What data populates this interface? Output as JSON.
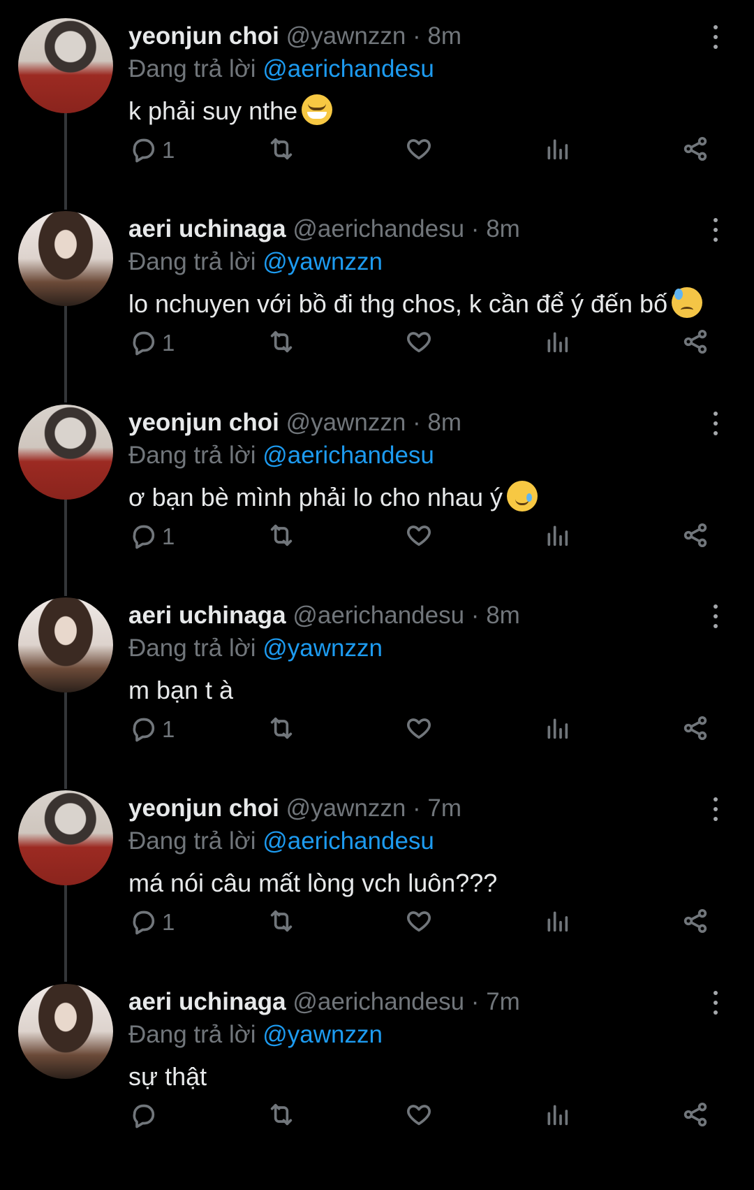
{
  "replying_prefix": "Đang trả lời",
  "tweets": [
    {
      "name": "yeonjun choi",
      "handle": "@yawnzzn",
      "time": "8m",
      "reply_to": "@aerichandesu",
      "text": "k phải suy nthe",
      "emoji": "sweat-smile",
      "replies": "1"
    },
    {
      "name": "aeri uchinaga",
      "handle": "@aerichandesu",
      "time": "8m",
      "reply_to": "@yawnzzn",
      "text": "lo nchuyen với bồ đi thg chos, k cần để ý đến bố",
      "emoji": "sad-sweat",
      "replies": "1"
    },
    {
      "name": "yeonjun choi",
      "handle": "@yawnzzn",
      "time": "8m",
      "reply_to": "@aerichandesu",
      "text": "ơ bạn bè mình phải lo cho nhau ý",
      "emoji": "tear-smile",
      "replies": "1"
    },
    {
      "name": "aeri uchinaga",
      "handle": "@aerichandesu",
      "time": "8m",
      "reply_to": "@yawnzzn",
      "text": "m bạn t à",
      "emoji": "",
      "replies": "1"
    },
    {
      "name": "yeonjun choi",
      "handle": "@yawnzzn",
      "time": "7m",
      "reply_to": "@aerichandesu",
      "text": "má nói câu mất lòng vch luôn???",
      "emoji": "",
      "replies": "1"
    },
    {
      "name": "aeri uchinaga",
      "handle": "@aerichandesu",
      "time": "7m",
      "reply_to": "@yawnzzn",
      "text": "sự thật",
      "emoji": "",
      "replies": ""
    }
  ],
  "icons": {
    "reply": "reply-icon",
    "retweet": "retweet-icon",
    "like": "heart-icon",
    "views": "views-icon",
    "share": "share-icon",
    "more": "more-vertical-icon"
  },
  "colors": {
    "background": "#000000",
    "text": "#e7e9ea",
    "secondary": "#71767b",
    "mention": "#1d9bf0"
  }
}
